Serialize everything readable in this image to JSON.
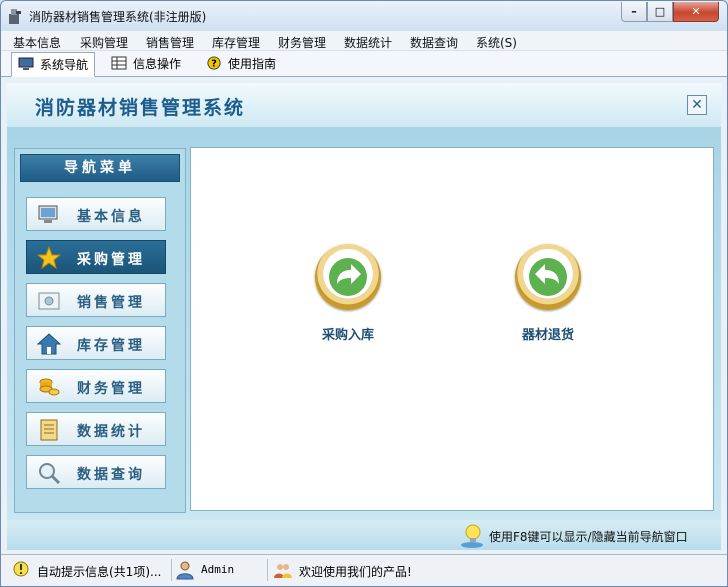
{
  "window": {
    "title": "消防器材销售管理系统(非注册版)"
  },
  "menubar": {
    "items": [
      "基本信息",
      "采购管理",
      "销售管理",
      "库存管理",
      "财务管理",
      "数据统计",
      "数据查询",
      "系统(S)"
    ]
  },
  "tabs": [
    {
      "label": "系统导航",
      "icon": "monitor-icon"
    },
    {
      "label": "信息操作",
      "icon": "grid-icon"
    },
    {
      "label": "使用指南",
      "icon": "help-icon"
    }
  ],
  "header": {
    "system_title": "消防器材销售管理系统",
    "close_glyph": "✕"
  },
  "nav": {
    "title": "导航菜单",
    "items": [
      {
        "label": "基本信息",
        "icon": "monitor-icon"
      },
      {
        "label": "采购管理",
        "icon": "star-icon"
      },
      {
        "label": "销售管理",
        "icon": "photo-icon"
      },
      {
        "label": "库存管理",
        "icon": "home-icon"
      },
      {
        "label": "财务管理",
        "icon": "coins-icon"
      },
      {
        "label": "数据统计",
        "icon": "ledger-icon"
      },
      {
        "label": "数据查询",
        "icon": "magnifier-icon"
      }
    ],
    "selected_index": 1
  },
  "content": {
    "actions": [
      {
        "label": "采购入库",
        "icon": "arrow-right-icon"
      },
      {
        "label": "器材退货",
        "icon": "arrow-left-icon"
      }
    ]
  },
  "footer": {
    "tip": "使用F8键可以显示/隐藏当前导航窗口"
  },
  "statusbar": {
    "auto_tip": "自动提示信息(共1项)...",
    "user": "Admin",
    "welcome": "欢迎使用我们的产品!"
  },
  "colors": {
    "accent": "#1f5c86",
    "title_blue": "#1d5d8c",
    "arrow_green": "#3f9a3a",
    "ring_gold": "#c79a2a"
  }
}
